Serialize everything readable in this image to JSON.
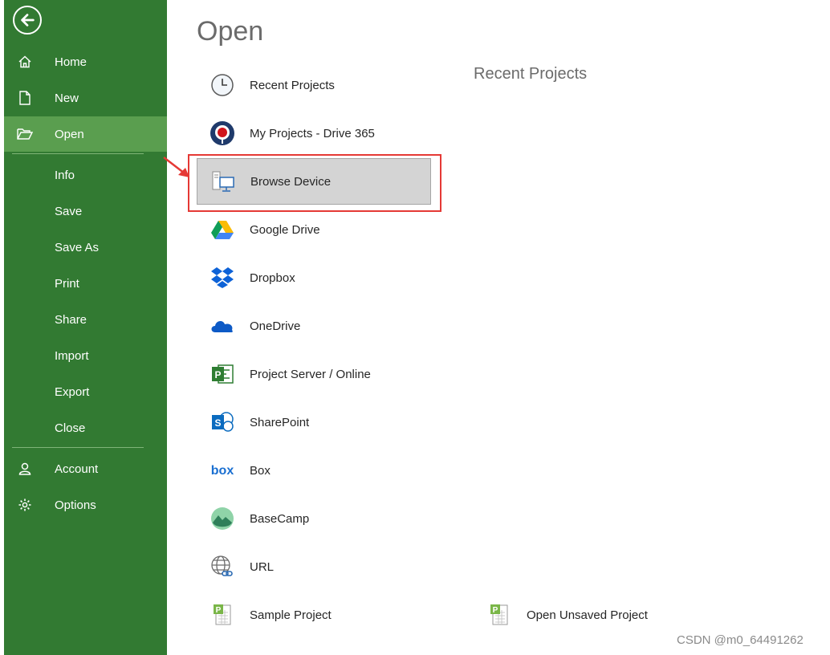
{
  "sidebar": {
    "back_icon": "back-arrow-icon",
    "items": [
      {
        "label": "Home",
        "icon": "home-icon"
      },
      {
        "label": "New",
        "icon": "new-file-icon"
      },
      {
        "label": "Open",
        "icon": "folder-open-icon",
        "selected": true
      },
      {
        "label": "Info"
      },
      {
        "label": "Save"
      },
      {
        "label": "Save As"
      },
      {
        "label": "Print"
      },
      {
        "label": "Share"
      },
      {
        "label": "Import"
      },
      {
        "label": "Export"
      },
      {
        "label": "Close"
      },
      {
        "label": "Account",
        "icon": "person-icon"
      },
      {
        "label": "Options",
        "icon": "gear-icon"
      }
    ]
  },
  "main": {
    "title": "Open",
    "recent_title": "Recent Projects",
    "locations": [
      {
        "label": "Recent Projects",
        "icon": "clock-icon"
      },
      {
        "label": "My Projects - Drive 365",
        "icon": "drive365-icon"
      },
      {
        "label": "Browse Device",
        "icon": "computer-icon",
        "selected": true
      },
      {
        "label": "Google Drive",
        "icon": "google-drive-icon"
      },
      {
        "label": "Dropbox",
        "icon": "dropbox-icon"
      },
      {
        "label": "OneDrive",
        "icon": "onedrive-icon"
      },
      {
        "label": "Project Server / Online",
        "icon": "project-server-icon"
      },
      {
        "label": "SharePoint",
        "icon": "sharepoint-icon"
      },
      {
        "label": "Box",
        "icon": "box-icon"
      },
      {
        "label": "BaseCamp",
        "icon": "basecamp-icon"
      },
      {
        "label": "URL",
        "icon": "globe-link-icon"
      },
      {
        "label": "Sample Project",
        "icon": "project-file-icon"
      }
    ],
    "open_unsaved": {
      "label": "Open Unsaved Project",
      "icon": "project-file-icon"
    }
  },
  "watermark": "CSDN @m0_64491262",
  "colors": {
    "sidebar": "#327a32",
    "selected_nav": "#5a9e4f",
    "highlight": "#e53935"
  }
}
